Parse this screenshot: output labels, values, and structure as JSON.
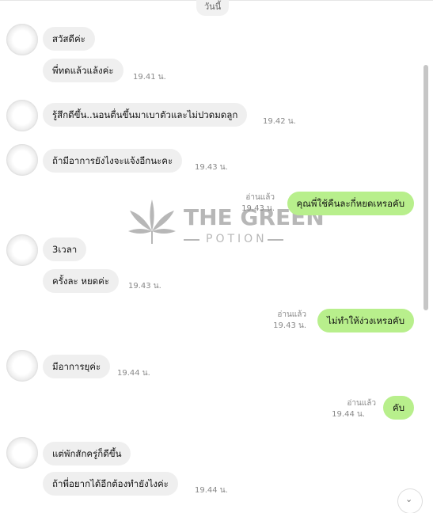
{
  "chat": {
    "date_label": "วันนี้",
    "watermark": {
      "title": "THE GREEN",
      "subtitle": "POTION"
    },
    "messages": [
      {
        "side": "in",
        "text": "สวัสดีค่ะ",
        "time": ""
      },
      {
        "side": "in",
        "text": "พี่ทดแล้วแล้งค่ะ",
        "time": "19.41 น."
      },
      {
        "side": "in",
        "text": "รู้สึกดีขึ้น..นอนตื่นขึ้นมาเบาตัวและไม่ปวดมดลูก",
        "time": "19.42 น."
      },
      {
        "side": "in",
        "text": "ถ้ามีอาการยังไงจะแจ้งอีกนะคะ",
        "time": "19.43 น."
      },
      {
        "side": "out",
        "text": "คุณพี่ใช้คืนละกี่หยดเหรอคับ",
        "read": "อ่านแล้ว",
        "time": "19.43 น."
      },
      {
        "side": "in",
        "text": "3เวลา",
        "time": ""
      },
      {
        "side": "in",
        "text": "ครั้งละ หยดค่ะ",
        "time": "19.43 น."
      },
      {
        "side": "out",
        "text": "ไม่ทำให้ง่วงเหรอคับ",
        "read": "อ่านแล้ว",
        "time": "19.43 น."
      },
      {
        "side": "in",
        "text": "มีอาการยุค่ะ",
        "time": "19.44 น."
      },
      {
        "side": "out",
        "text": "คับ",
        "read": "อ่านแล้ว",
        "time": "19.44 น."
      },
      {
        "side": "in",
        "text": "แต่พักสักครู่ก็ดีขึ้น",
        "time": ""
      },
      {
        "side": "in",
        "text": "ถ้าพี่อยากได้อีกต้องทำยังไงค่ะ",
        "time": "19.44 น."
      }
    ]
  }
}
